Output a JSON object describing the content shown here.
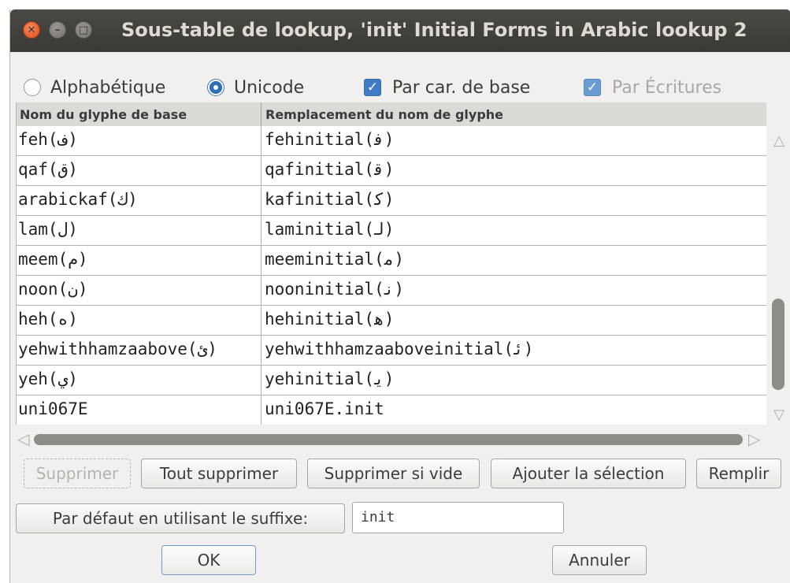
{
  "window": {
    "title": "Sous-table de lookup, 'init' Initial Forms in Arabic lookup 2"
  },
  "options": {
    "alphabetique": {
      "label": "Alphabétique",
      "selected": false
    },
    "unicode": {
      "label": "Unicode",
      "selected": true
    },
    "par_car_de_base": {
      "label": "Par car. de base",
      "checked": true
    },
    "par_ecritures": {
      "label": "Par Écritures",
      "checked": true,
      "disabled": true
    }
  },
  "table": {
    "columns": [
      "Nom du glyphe de base",
      "Remplacement du nom de glyphe"
    ],
    "rows": [
      [
        "feh(ف)",
        "fehinitial(ﻓ)"
      ],
      [
        "qaf(ق)",
        "qafinitial(ﻗ)"
      ],
      [
        "arabickaf(ك)",
        "kafinitial(ﻛ)"
      ],
      [
        "lam(ل)",
        "laminitial(ﻟ)"
      ],
      [
        "meem(م)",
        "meeminitial(ﻣ)"
      ],
      [
        "noon(ن)",
        "nooninitial(ﻧ)"
      ],
      [
        "heh(ه)",
        "hehinitial(ﻫ)"
      ],
      [
        "yehwithhamzaabove(ئ)",
        "yehwithhamzaaboveinitial(ﺋ)"
      ],
      [
        "yeh(ي)",
        "yehinitial(ﻳ)"
      ],
      [
        "uni067E",
        "uni067E.init"
      ]
    ]
  },
  "buttons": {
    "supprimer": "Supprimer",
    "tout_supprimer": "Tout supprimer",
    "supprimer_si_vide": "Supprimer si vide",
    "ajouter_selection": "Ajouter la sélection",
    "remplir": "Remplir",
    "par_defaut": "Par défaut en utilisant le suffixe:",
    "ok": "OK",
    "annuler": "Annuler"
  },
  "suffix_field": {
    "value": "init"
  },
  "icons": {
    "close": "close-icon",
    "minimize": "minimize-icon",
    "maximize": "maximize-icon",
    "checkmark": "✓"
  },
  "colors": {
    "accent": "#2f6fb7",
    "titlebar": "#3a3935",
    "close_button": "#df4b16"
  }
}
